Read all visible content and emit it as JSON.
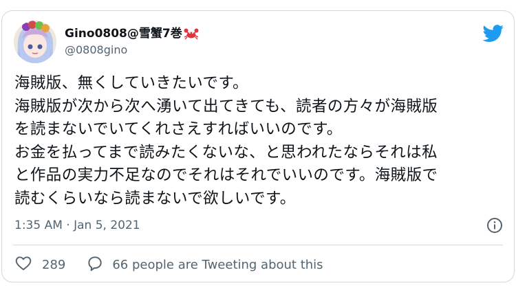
{
  "tweet": {
    "display_name": "Gino0808@雪蟹7巻",
    "handle": "@0808gino",
    "text": "海賊版、無くしていきたいです。\n海賊版が次から次へ湧いて出てきても、読者の方々が海賊版\nを読まないでいてくれさえすればいいのです。\nお金を払ってまで読みたくないな、と思われたならそれは私\nと作品の実力不足なのでそれはそれでいいのです。海賊版で\n読むくらいなら読まないで欲しいです。",
    "timestamp": "1:35 AM · Jan 5, 2021",
    "like_count": "289",
    "reply_label": "66 people are Tweeting about this"
  },
  "icons": {
    "brand": "twitter-bird-icon",
    "name_emoji": "crab-icon",
    "info": "info-icon",
    "like": "heart-icon",
    "reply": "speech-bubble-icon"
  },
  "colors": {
    "brand_blue": "#1d9bf0",
    "text_primary": "#0f1419",
    "text_secondary": "#536471",
    "border": "#cfd9de",
    "crab_red": "#e0343e"
  }
}
